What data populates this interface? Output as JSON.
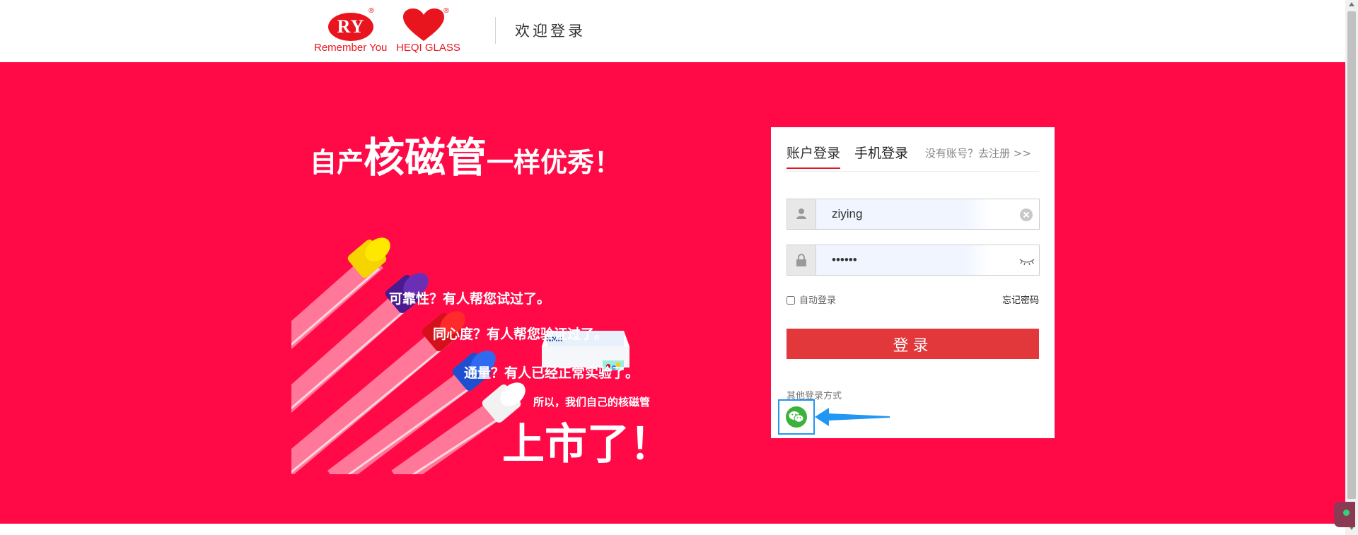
{
  "header": {
    "ry_logo": {
      "badge": "RY",
      "text": "Remember You",
      "reg": "®"
    },
    "heqi_logo": {
      "text": "HEQI GLASS",
      "reg": "®"
    },
    "welcome": "欢迎登录"
  },
  "banner": {
    "background_color": "#ff0a47",
    "slogan": {
      "part1": "自产",
      "part2": "核磁管",
      "part3": "一样优秀！"
    },
    "promo": {
      "line1": "可靠性？有人帮您试过了。",
      "line2": "同心度？有人帮您验证过了。",
      "line3": "通量？有人已经正常实验了。",
      "line4": "所以，我们自己的核磁管",
      "line5": "上市了！",
      "box_label": "NMR"
    }
  },
  "login": {
    "tabs": [
      {
        "label": "账户登录",
        "active": true
      },
      {
        "label": "手机登录",
        "active": false
      }
    ],
    "register_link": "没有账号？去注册 >>",
    "username": {
      "value": "ziying",
      "icon": "user-icon",
      "clear_icon": "clear-icon"
    },
    "password": {
      "value": "••••••",
      "icon": "lock-icon",
      "toggle_icon": "eye-closed-icon"
    },
    "auto_login_label": "自动登录",
    "auto_login_checked": false,
    "forgot_password": "忘记密码",
    "submit_label": "登录",
    "submit_color": "#e2373b",
    "other_methods_label": "其他登录方式",
    "wechat_icon": "wechat-icon"
  }
}
